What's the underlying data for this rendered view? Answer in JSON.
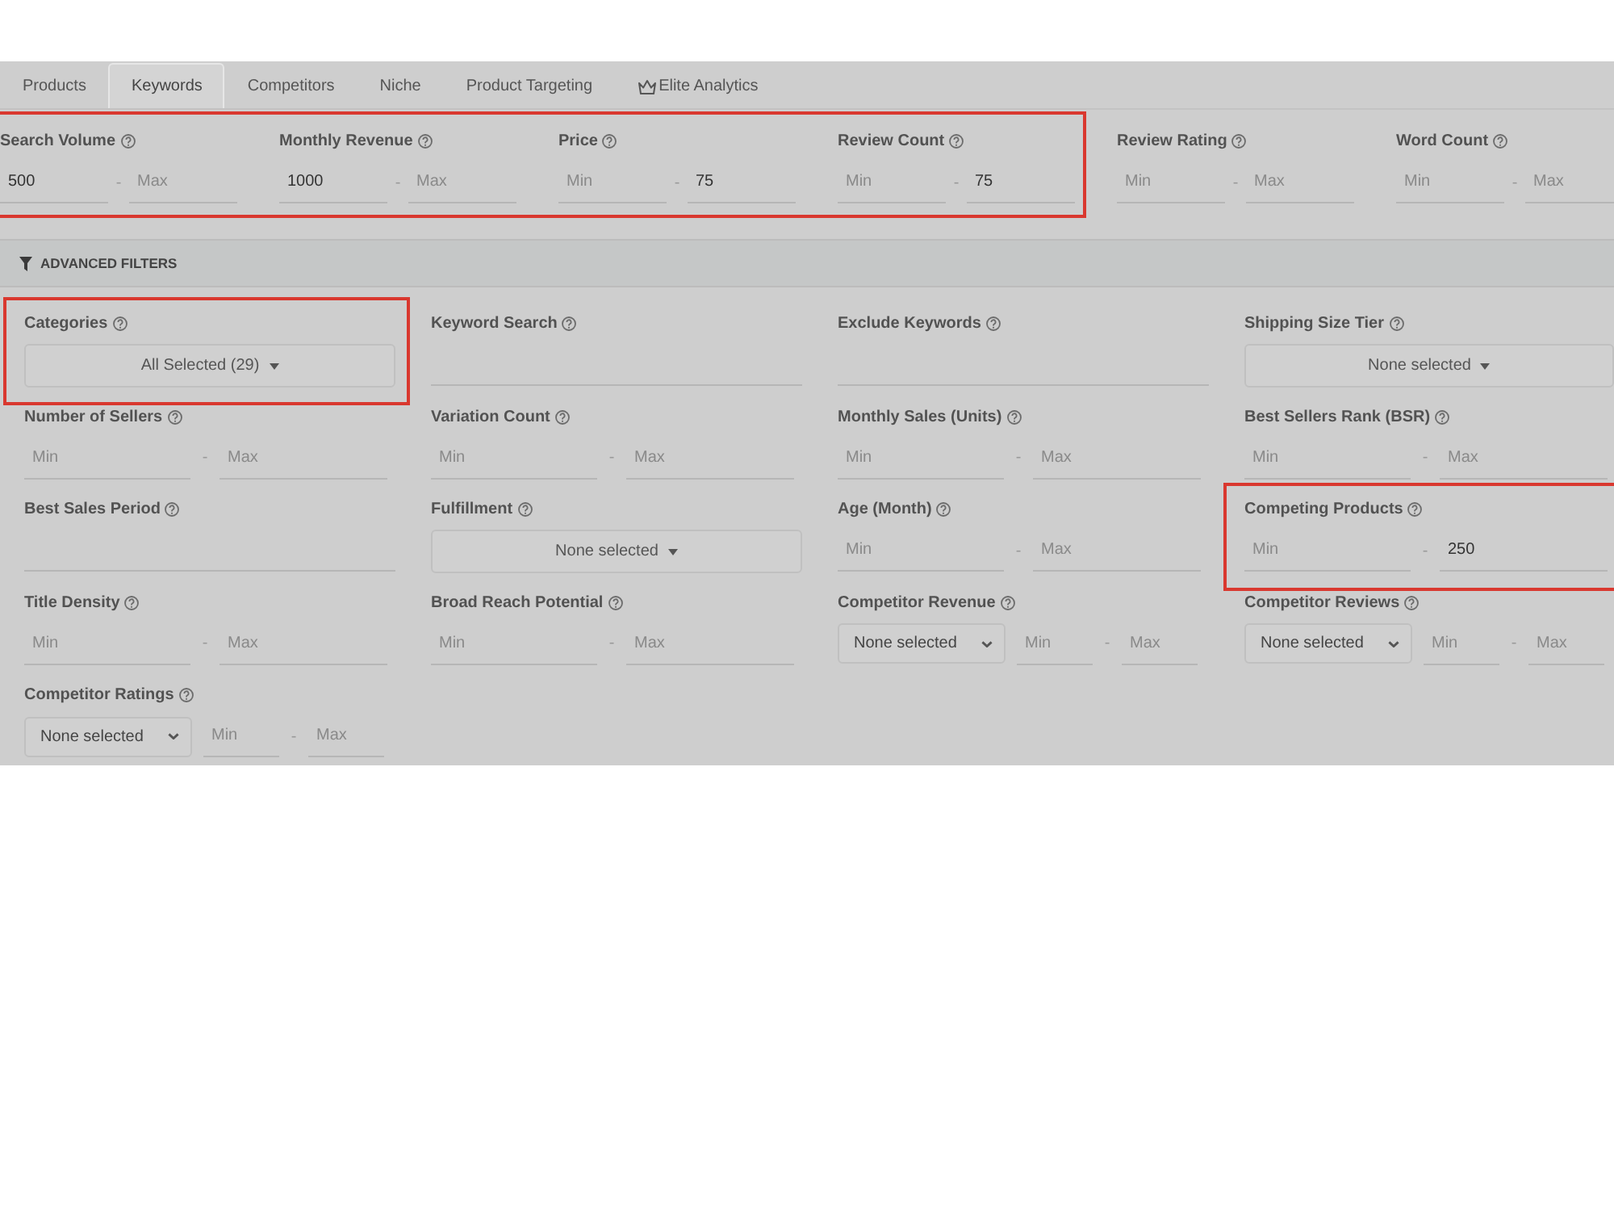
{
  "tabs": [
    {
      "label": "Products",
      "kind": "plain",
      "selected": false
    },
    {
      "label": "Keywords",
      "kind": "plain",
      "selected": true
    },
    {
      "label": "Competitors",
      "kind": "plain",
      "selected": false
    },
    {
      "label": "Niche",
      "kind": "plain",
      "selected": false
    },
    {
      "label": "Product Targeting",
      "kind": "plain",
      "selected": false
    },
    {
      "label": "Elite Analytics",
      "kind": "premium",
      "selected": false
    }
  ],
  "top_filters": [
    {
      "label": "Search Volume",
      "highlighted": true,
      "min": {
        "value": "500"
      },
      "separator": "-",
      "max": {
        "placeholder": "Max"
      }
    },
    {
      "label": "Monthly Revenue",
      "highlighted": true,
      "min": {
        "value": "1000"
      },
      "separator": "-",
      "max": {
        "placeholder": "Max"
      }
    },
    {
      "label": "Price",
      "highlighted": true,
      "min": {
        "placeholder": "Min"
      },
      "separator": "-",
      "max": {
        "value": "75"
      }
    },
    {
      "label": "Review Count",
      "highlighted": true,
      "min": {
        "placeholder": "Min"
      },
      "separator": "-",
      "max": {
        "value": "75"
      }
    },
    {
      "label": "Review Rating",
      "highlighted": false,
      "min": {
        "placeholder": "Min"
      },
      "separator": "-",
      "max": {
        "placeholder": "Max"
      }
    },
    {
      "label": "Word Count",
      "highlighted": false,
      "min": {
        "placeholder": "Min"
      },
      "separator": "-",
      "max": {
        "placeholder": "Max"
      }
    }
  ],
  "advanced_filters": {
    "title": "ADVANCED FILTERS"
  },
  "fields": [
    {
      "label": "Categories",
      "kind": "dropdown",
      "highlighted": true,
      "value": "All Selected (29)"
    },
    {
      "label": "Keyword Search",
      "kind": "text",
      "highlighted": false
    },
    {
      "label": "Exclude Keywords",
      "kind": "text",
      "highlighted": false
    },
    {
      "label": "Shipping Size Tier",
      "kind": "dropdown",
      "highlighted": false,
      "value": "None selected"
    },
    {
      "label": "Number of Sellers",
      "kind": "range",
      "highlighted": false,
      "min": {
        "placeholder": "Min"
      },
      "separator": "-",
      "max": {
        "placeholder": "Max"
      }
    },
    {
      "label": "Variation Count",
      "kind": "range",
      "highlighted": false,
      "min": {
        "placeholder": "Min"
      },
      "separator": "-",
      "max": {
        "placeholder": "Max"
      }
    },
    {
      "label": "Monthly Sales (Units)",
      "kind": "range",
      "highlighted": false,
      "min": {
        "placeholder": "Min"
      },
      "separator": "-",
      "max": {
        "placeholder": "Max"
      }
    },
    {
      "label": "Best Sellers Rank (BSR)",
      "kind": "range",
      "highlighted": false,
      "min": {
        "placeholder": "Min"
      },
      "separator": "-",
      "max": {
        "placeholder": "Max"
      }
    },
    {
      "label": "Best Sales Period",
      "kind": "text",
      "highlighted": false
    },
    {
      "label": "Fulfillment",
      "kind": "dropdown",
      "highlighted": false,
      "value": "None selected"
    },
    {
      "label": "Age (Month)",
      "kind": "range",
      "highlighted": false,
      "min": {
        "placeholder": "Min"
      },
      "separator": "-",
      "max": {
        "placeholder": "Max"
      }
    },
    {
      "label": "Competing Products",
      "kind": "range",
      "highlighted": true,
      "min": {
        "placeholder": "Min"
      },
      "separator": "-",
      "max": {
        "value": "250"
      }
    },
    {
      "label": "Title Density",
      "kind": "range",
      "highlighted": false,
      "min": {
        "placeholder": "Min"
      },
      "separator": "-",
      "max": {
        "placeholder": "Max"
      }
    },
    {
      "label": "Broad Reach Potential",
      "kind": "range",
      "highlighted": false,
      "min": {
        "placeholder": "Min"
      },
      "separator": "-",
      "max": {
        "placeholder": "Max"
      }
    },
    {
      "label": "Competitor Revenue",
      "kind": "select_range",
      "highlighted": false,
      "select": {
        "value": "None selected"
      },
      "min": {
        "placeholder": "Min"
      },
      "separator": "-",
      "max": {
        "placeholder": "Max"
      }
    },
    {
      "label": "Competitor Reviews",
      "kind": "select_range",
      "highlighted": false,
      "select": {
        "value": "None selected"
      },
      "min": {
        "placeholder": "Min"
      },
      "separator": "-",
      "max": {
        "placeholder": "Max"
      }
    },
    {
      "label": "Competitor Ratings",
      "kind": "select_range",
      "highlighted": false,
      "select": {
        "value": "None selected"
      },
      "min": {
        "placeholder": "Min"
      },
      "separator": "-",
      "max": {
        "placeholder": "Max"
      }
    }
  ]
}
